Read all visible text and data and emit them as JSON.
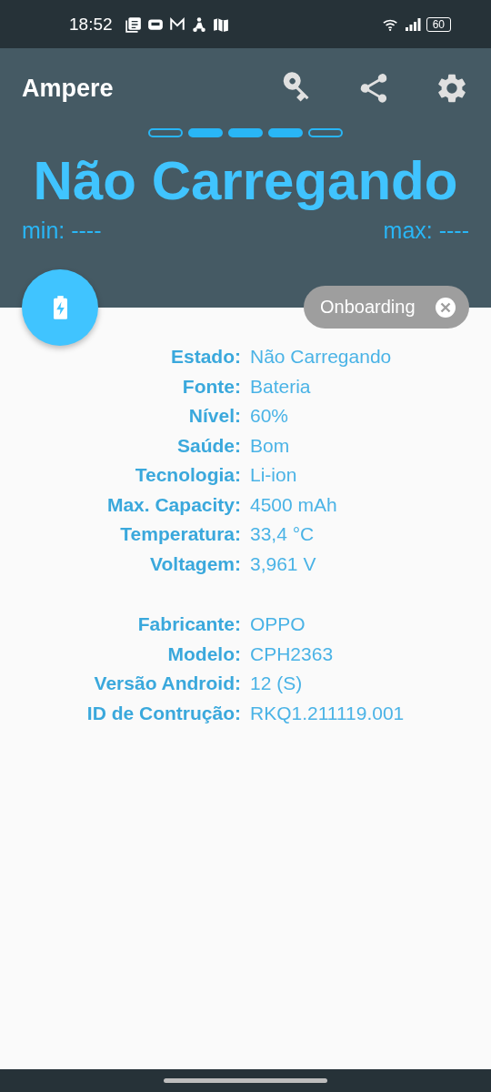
{
  "status_bar": {
    "time": "18:52",
    "battery": "60"
  },
  "app_bar": {
    "title": "Ampere"
  },
  "indicator": [
    {
      "filled": false
    },
    {
      "filled": true
    },
    {
      "filled": true
    },
    {
      "filled": true
    },
    {
      "filled": false
    }
  ],
  "state_title": "Não Carregando",
  "min": "min: ----",
  "max": "max: ----",
  "chip": {
    "label": "Onboarding"
  },
  "sections": [
    [
      {
        "label": "Estado:",
        "value": "Não Carregando"
      },
      {
        "label": "Fonte:",
        "value": "Bateria"
      },
      {
        "label": "Nível:",
        "value": "60%"
      },
      {
        "label": "Saúde:",
        "value": "Bom"
      },
      {
        "label": "Tecnologia:",
        "value": "Li-ion"
      },
      {
        "label": "Max. Capacity:",
        "value": "4500 mAh"
      },
      {
        "label": "Temperatura:",
        "value": "33,4 °C"
      },
      {
        "label": "Voltagem:",
        "value": "3,961 V"
      }
    ],
    [
      {
        "label": "Fabricante:",
        "value": "OPPO"
      },
      {
        "label": "Modelo:",
        "value": "CPH2363"
      },
      {
        "label": "Versão Android:",
        "value": "12 (S)"
      },
      {
        "label": "ID de Contrução:",
        "value": "RKQ1.211119.001"
      }
    ]
  ]
}
